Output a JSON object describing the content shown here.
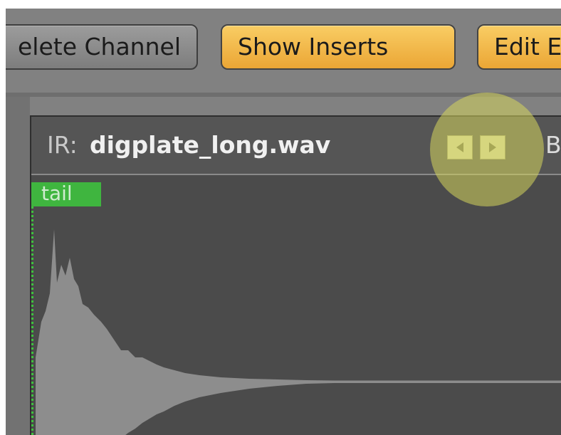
{
  "toolbar": {
    "delete_channel_label": "elete Channel",
    "show_inserts_label": "Show Inserts",
    "edit_label": "Edit E"
  },
  "ir": {
    "prefix": "IR:",
    "filename": "digplate_long.wav",
    "cut_text": "B"
  },
  "waveform": {
    "tail_label": "tail"
  },
  "colors": {
    "orange_button": "#f3b94b",
    "grey_button": "#8c8c8c",
    "tail_marker": "#3fb53f",
    "highlight": "#d6d65c",
    "waveform": "#8d8d8d"
  },
  "icons": {
    "prev": "triangle-left",
    "next": "triangle-right"
  }
}
